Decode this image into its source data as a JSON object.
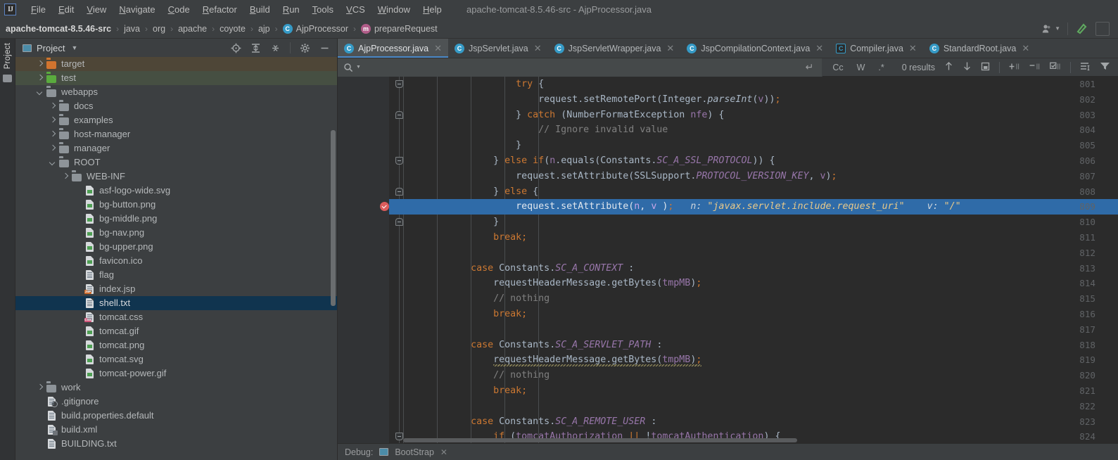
{
  "window": {
    "title": "apache-tomcat-8.5.46-src - AjpProcessor.java"
  },
  "menubar": {
    "logo": "IJ",
    "items": [
      "File",
      "Edit",
      "View",
      "Navigate",
      "Code",
      "Refactor",
      "Build",
      "Run",
      "Tools",
      "VCS",
      "Window",
      "Help"
    ]
  },
  "navbar": {
    "breadcrumbs": [
      {
        "label": "apache-tomcat-8.5.46-src",
        "icon": null
      },
      {
        "label": "java",
        "icon": null
      },
      {
        "label": "org",
        "icon": null
      },
      {
        "label": "apache",
        "icon": null
      },
      {
        "label": "coyote",
        "icon": null
      },
      {
        "label": "ajp",
        "icon": null
      },
      {
        "label": "AjpProcessor",
        "icon": "class-icon"
      },
      {
        "label": "prepareRequest",
        "icon": "method-icon"
      }
    ],
    "right_icons": [
      "user-icon",
      "chevron-down-icon",
      "build-hammer-icon",
      "run-button"
    ]
  },
  "toolstripe": {
    "label": "Project",
    "icon": "folder-icon"
  },
  "project_panel": {
    "title": "Project",
    "window_icon": "project-window-icon",
    "toolbar_icons": [
      "locate-icon",
      "expand-all-icon",
      "collapse-all-icon",
      "settings-gear-icon",
      "hide-icon"
    ],
    "tree": [
      {
        "label": "target",
        "indent": 1,
        "arrow": "right",
        "icon": "folder-orange",
        "state": "hl-target"
      },
      {
        "label": "test",
        "indent": 1,
        "arrow": "right",
        "icon": "folder-green",
        "state": "hl-test"
      },
      {
        "label": "webapps",
        "indent": 1,
        "arrow": "down",
        "icon": "folder-gray",
        "state": ""
      },
      {
        "label": "docs",
        "indent": 2,
        "arrow": "right",
        "icon": "folder-gray",
        "state": ""
      },
      {
        "label": "examples",
        "indent": 2,
        "arrow": "right",
        "icon": "folder-gray",
        "state": ""
      },
      {
        "label": "host-manager",
        "indent": 2,
        "arrow": "right",
        "icon": "folder-gray",
        "state": ""
      },
      {
        "label": "manager",
        "indent": 2,
        "arrow": "right",
        "icon": "folder-gray",
        "state": ""
      },
      {
        "label": "ROOT",
        "indent": 2,
        "arrow": "down",
        "icon": "folder-gray",
        "state": ""
      },
      {
        "label": "WEB-INF",
        "indent": 3,
        "arrow": "right",
        "icon": "folder-gray",
        "state": ""
      },
      {
        "label": "asf-logo-wide.svg",
        "indent": 4,
        "arrow": "none",
        "icon": "file-image",
        "state": ""
      },
      {
        "label": "bg-button.png",
        "indent": 4,
        "arrow": "none",
        "icon": "file-image",
        "state": ""
      },
      {
        "label": "bg-middle.png",
        "indent": 4,
        "arrow": "none",
        "icon": "file-image",
        "state": ""
      },
      {
        "label": "bg-nav.png",
        "indent": 4,
        "arrow": "none",
        "icon": "file-image",
        "state": ""
      },
      {
        "label": "bg-upper.png",
        "indent": 4,
        "arrow": "none",
        "icon": "file-image",
        "state": ""
      },
      {
        "label": "favicon.ico",
        "indent": 4,
        "arrow": "none",
        "icon": "file-image",
        "state": ""
      },
      {
        "label": "flag",
        "indent": 4,
        "arrow": "none",
        "icon": "file-text",
        "state": ""
      },
      {
        "label": "index.jsp",
        "indent": 4,
        "arrow": "none",
        "icon": "file-jsp",
        "state": ""
      },
      {
        "label": "shell.txt",
        "indent": 4,
        "arrow": "none",
        "icon": "file-text",
        "state": "selected"
      },
      {
        "label": "tomcat.css",
        "indent": 4,
        "arrow": "none",
        "icon": "file-css",
        "state": ""
      },
      {
        "label": "tomcat.gif",
        "indent": 4,
        "arrow": "none",
        "icon": "file-image",
        "state": ""
      },
      {
        "label": "tomcat.png",
        "indent": 4,
        "arrow": "none",
        "icon": "file-image",
        "state": ""
      },
      {
        "label": "tomcat.svg",
        "indent": 4,
        "arrow": "none",
        "icon": "file-image",
        "state": ""
      },
      {
        "label": "tomcat-power.gif",
        "indent": 4,
        "arrow": "none",
        "icon": "file-image",
        "state": ""
      },
      {
        "label": "work",
        "indent": 1,
        "arrow": "right",
        "icon": "folder-gray",
        "state": ""
      },
      {
        "label": ".gitignore",
        "indent": 1,
        "arrow": "none",
        "icon": "file-gitignore",
        "state": ""
      },
      {
        "label": "build.properties.default",
        "indent": 1,
        "arrow": "none",
        "icon": "file-text",
        "state": ""
      },
      {
        "label": "build.xml",
        "indent": 1,
        "arrow": "none",
        "icon": "file-xml",
        "state": ""
      },
      {
        "label": "BUILDING.txt",
        "indent": 1,
        "arrow": "none",
        "icon": "file-text",
        "state": ""
      }
    ]
  },
  "editor": {
    "tabs": [
      {
        "label": "AjpProcessor.java",
        "icon": "class-icon",
        "active": true
      },
      {
        "label": "JspServlet.java",
        "icon": "class-icon",
        "active": false
      },
      {
        "label": "JspServletWrapper.java",
        "icon": "class-icon",
        "active": false
      },
      {
        "label": "JspCompilationContext.java",
        "icon": "class-icon",
        "active": false
      },
      {
        "label": "Compiler.java",
        "icon": "abstract-class-icon",
        "active": false
      },
      {
        "label": "StandardRoot.java",
        "icon": "class-icon",
        "active": false
      }
    ],
    "findbar": {
      "search_value": "",
      "search_placeholder": "",
      "search_icon": "magnifier-icon",
      "history_icon": "chevron-down-icon",
      "newline_icon": "multiline-icon",
      "toggles": [
        {
          "label": "Cc",
          "name": "match-case-toggle"
        },
        {
          "label": "W",
          "name": "words-toggle"
        },
        {
          "label": ".*",
          "name": "regex-toggle"
        }
      ],
      "results": "0 results",
      "nav_icons": [
        "prev-match-icon",
        "next-match-icon",
        "select-all-occurrences-icon"
      ],
      "action_icons": [
        "add-selection-icon",
        "remove-selection-icon",
        "select-all-icon"
      ],
      "right_icons": [
        "filter-options-icon",
        "filter-icon"
      ]
    },
    "first_line_number": 801,
    "current_line": 809,
    "breakpoint_line": 809,
    "lines": [
      {
        "n": 801,
        "indent": 0,
        "fold": "open",
        "text": "                    try {"
      },
      {
        "n": 802,
        "indent": 0,
        "fold": null,
        "text": "                        request.setRemotePort(Integer.parseInt(v));"
      },
      {
        "n": 803,
        "indent": 0,
        "fold": "close",
        "text": "                    } catch (NumberFormatException nfe) {"
      },
      {
        "n": 804,
        "indent": 0,
        "fold": null,
        "text": "                        // Ignore invalid value"
      },
      {
        "n": 805,
        "indent": 0,
        "fold": null,
        "text": "                    }"
      },
      {
        "n": 806,
        "indent": 0,
        "fold": "open",
        "text": "                } else if(n.equals(Constants.SC_A_SSL_PROTOCOL)) {"
      },
      {
        "n": 807,
        "indent": 0,
        "fold": null,
        "text": "                    request.setAttribute(SSLSupport.PROTOCOL_VERSION_KEY, v);"
      },
      {
        "n": 808,
        "indent": 0,
        "fold": "close",
        "text": "                } else {"
      },
      {
        "n": 809,
        "indent": 0,
        "fold": null,
        "text": "                    request.setAttribute(n, v );   n: \"javax.servlet.include.request_uri\"    v: \"/\""
      },
      {
        "n": 810,
        "indent": 0,
        "fold": "close",
        "text": "                }"
      },
      {
        "n": 811,
        "indent": 0,
        "fold": null,
        "text": "                break;"
      },
      {
        "n": 812,
        "indent": 0,
        "fold": null,
        "text": ""
      },
      {
        "n": 813,
        "indent": 0,
        "fold": null,
        "text": "            case Constants.SC_A_CONTEXT :"
      },
      {
        "n": 814,
        "indent": 0,
        "fold": null,
        "text": "                requestHeaderMessage.getBytes(tmpMB);"
      },
      {
        "n": 815,
        "indent": 0,
        "fold": null,
        "text": "                // nothing"
      },
      {
        "n": 816,
        "indent": 0,
        "fold": null,
        "text": "                break;"
      },
      {
        "n": 817,
        "indent": 0,
        "fold": null,
        "text": ""
      },
      {
        "n": 818,
        "indent": 0,
        "fold": null,
        "text": "            case Constants.SC_A_SERVLET_PATH :"
      },
      {
        "n": 819,
        "indent": 0,
        "fold": null,
        "text": "                requestHeaderMessage.getBytes(tmpMB);"
      },
      {
        "n": 820,
        "indent": 0,
        "fold": null,
        "text": "                // nothing"
      },
      {
        "n": 821,
        "indent": 0,
        "fold": null,
        "text": "                break;"
      },
      {
        "n": 822,
        "indent": 0,
        "fold": null,
        "text": ""
      },
      {
        "n": 823,
        "indent": 0,
        "fold": null,
        "text": "            case Constants.SC_A_REMOTE_USER :"
      },
      {
        "n": 824,
        "indent": 0,
        "fold": "open",
        "text": "                if (tomcatAuthorization || !tomcatAuthentication) {"
      }
    ],
    "debug_hints": {
      "line": 809,
      "n_label": "n:",
      "n_value": "\"javax.servlet.include.request_uri\"",
      "v_label": "v:",
      "v_value": "\"/\""
    }
  },
  "bottombar": {
    "label": "Debug:",
    "config_icon": "run-config-icon",
    "config_name": "BootStrap",
    "close_icon": "close-icon"
  },
  "colors": {
    "accent_tab": "#4a88c7",
    "current_line": "#2f6ba8",
    "selection": "#10344f",
    "breakpoint": "#db5c5c",
    "folder_orange": "#d1742e",
    "folder_green": "#5aab3e",
    "keyword": "#cc7832",
    "string": "#6a8759",
    "field": "#9876aa",
    "comment": "#808080",
    "plain": "#a9b7c6",
    "background_editor": "#2b2b2b",
    "background_ui": "#3c3f41"
  }
}
